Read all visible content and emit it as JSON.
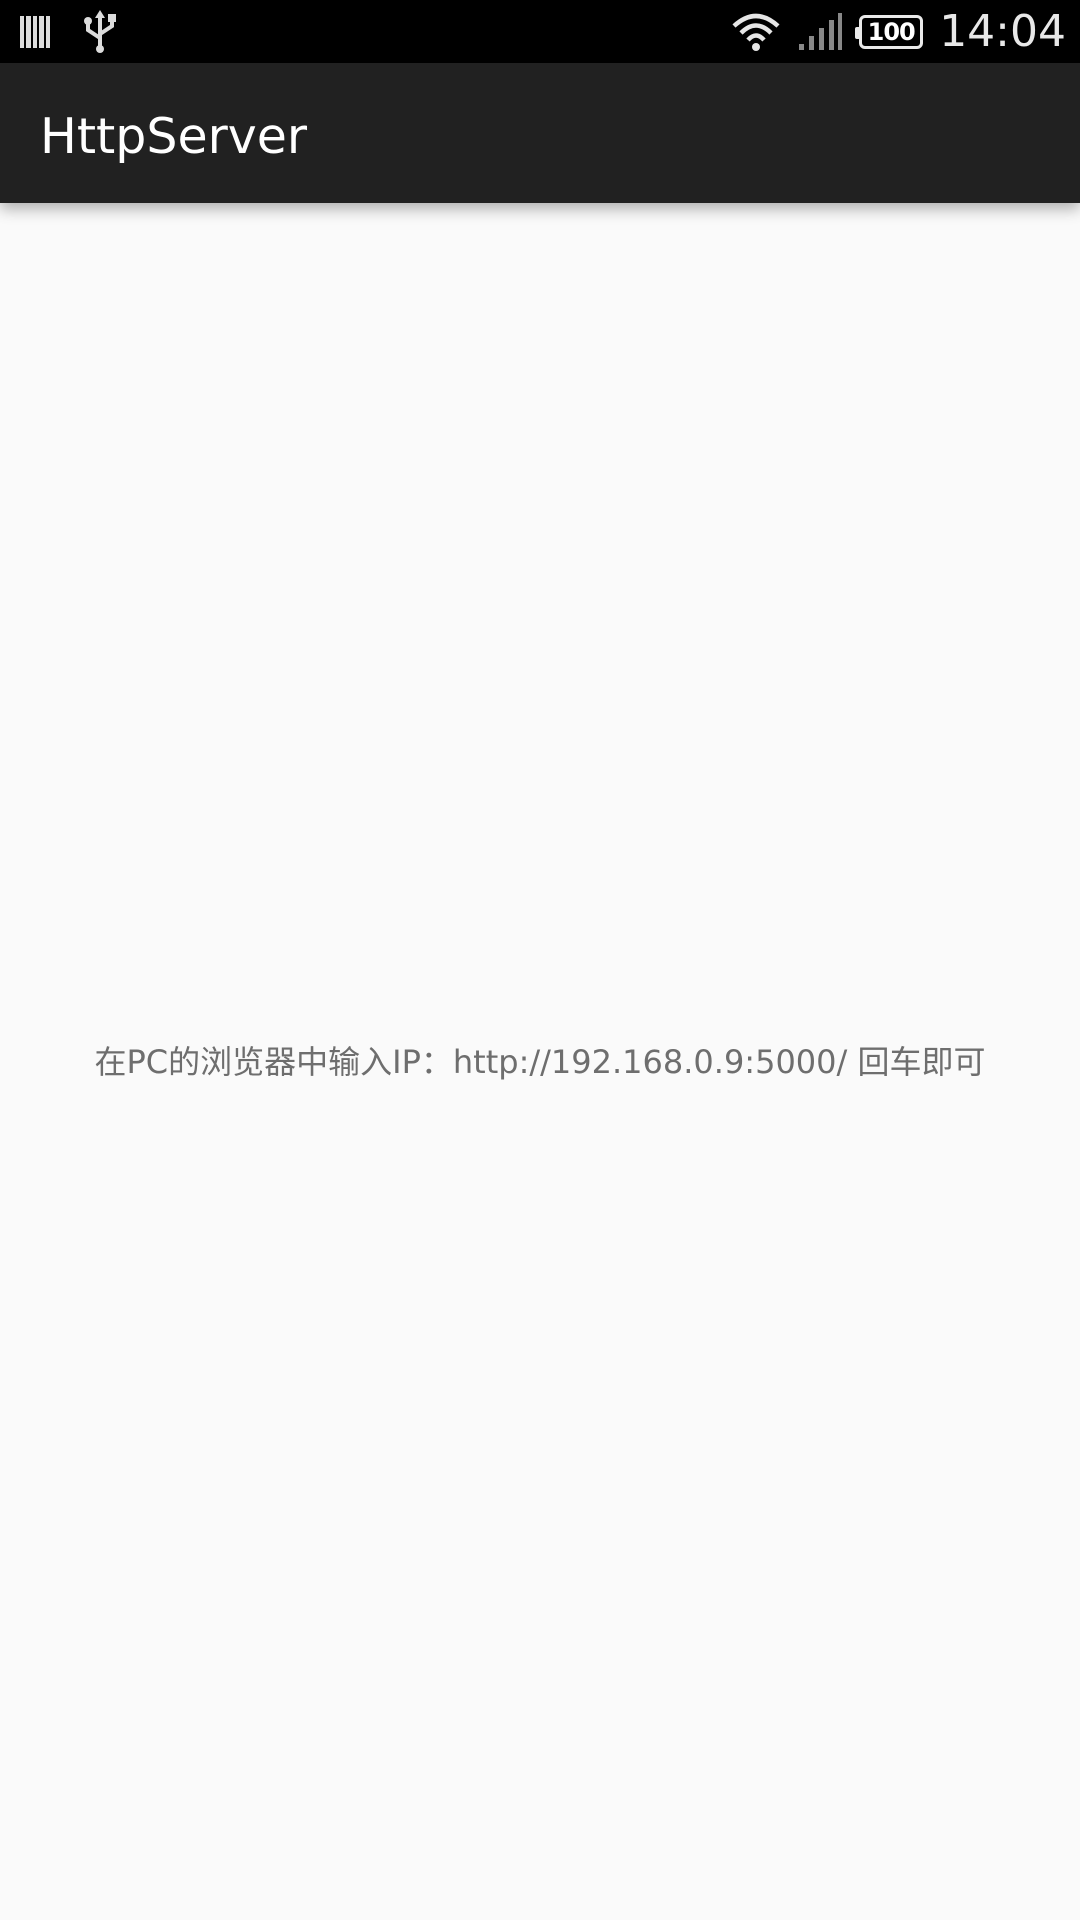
{
  "status_bar": {
    "left_icons": [
      "barcode-icon",
      "usb-icon"
    ],
    "right_icons": [
      "wifi-icon",
      "signal-icon"
    ],
    "battery_level": "100",
    "time": "14:04"
  },
  "app_bar": {
    "title": "HttpServer"
  },
  "main": {
    "instruction": "在PC的浏览器中输入IP：http://192.168.0.9:5000/ 回车即可"
  },
  "colors": {
    "status_bar_bg": "#000000",
    "app_bar_bg": "#212121",
    "content_bg": "#fafafa",
    "text_secondary": "#6e6e6e"
  }
}
